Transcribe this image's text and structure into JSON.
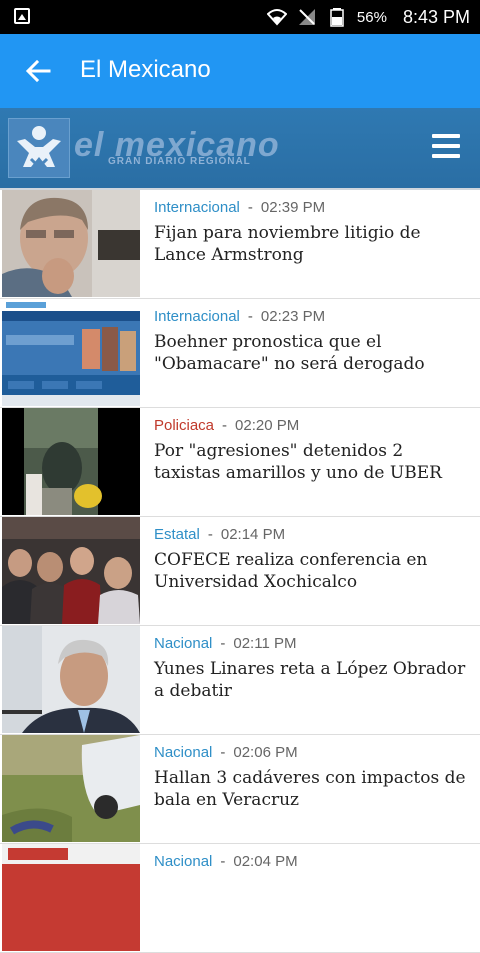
{
  "status_bar": {
    "battery": "56%",
    "time": "8:43 PM"
  },
  "app_bar": {
    "title": "El Mexicano"
  },
  "site_header": {
    "logo_text": "el mexicano",
    "logo_subtitle": "GRAN DIARIO REGIONAL"
  },
  "news": [
    {
      "category": "Internacional",
      "time": "02:39 PM",
      "headline": "Fijan para noviembre litigio de Lance Armstrong"
    },
    {
      "category": "Internacional",
      "time": "02:23 PM",
      "headline": "Boehner pronostica que el \"Obamacare\" no será derogado"
    },
    {
      "category": "Policiaca",
      "time": "02:20 PM",
      "headline": "Por \"agresiones\" detenidos 2 taxistas amarillos y uno de UBER"
    },
    {
      "category": "Estatal",
      "time": "02:14 PM",
      "headline": "COFECE realiza conferencia en Universidad Xochicalco"
    },
    {
      "category": "Nacional",
      "time": "02:11 PM",
      "headline": "Yunes Linares reta a López Obrador a debatir"
    },
    {
      "category": "Nacional",
      "time": "02:06 PM",
      "headline": "Hallan 3 cadáveres con impactos de bala en Veracruz"
    },
    {
      "category": "Nacional",
      "time": "02:04 PM",
      "headline": ""
    }
  ]
}
